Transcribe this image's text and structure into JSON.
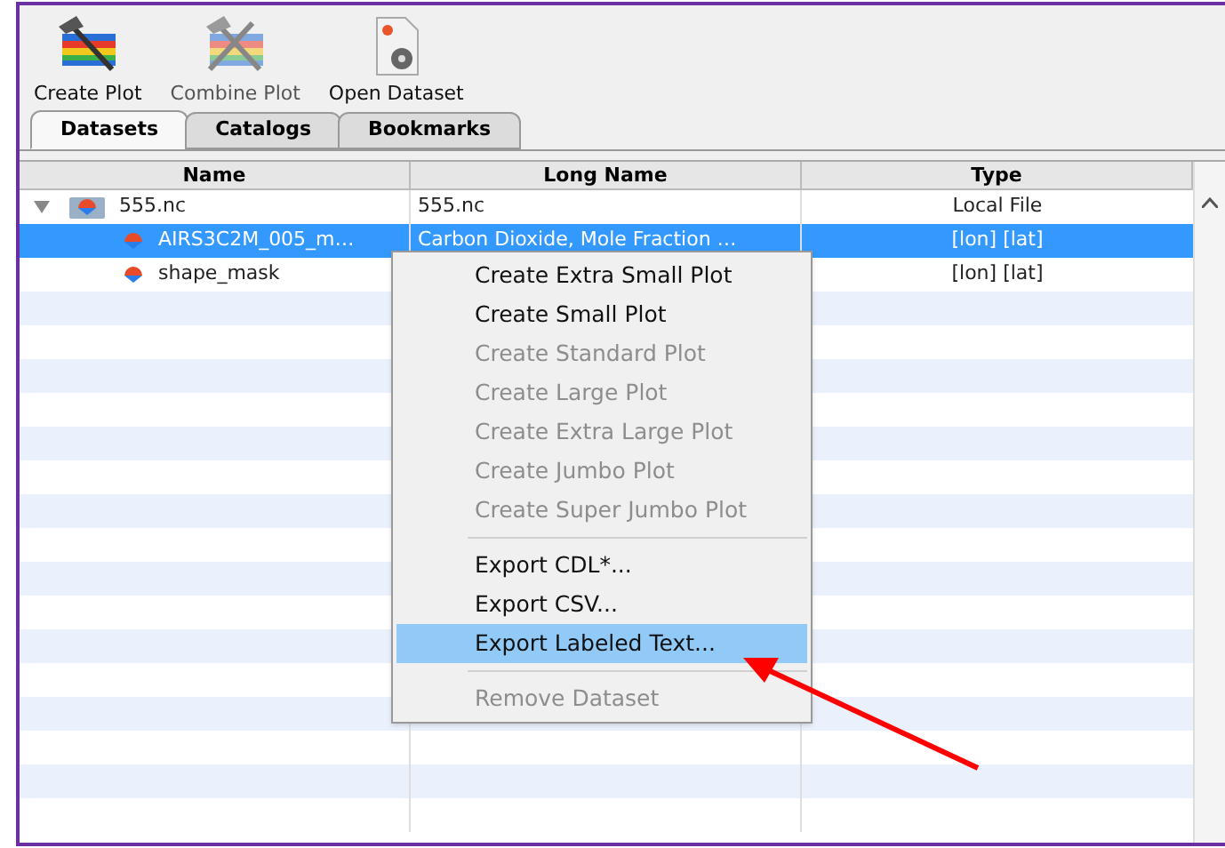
{
  "toolbar": [
    {
      "label": "Create Plot",
      "kind": "create",
      "disabled": false
    },
    {
      "label": "Combine Plot",
      "kind": "combine",
      "disabled": true
    },
    {
      "label": "Open Dataset",
      "kind": "open",
      "disabled": false
    }
  ],
  "tabs": [
    {
      "label": "Datasets",
      "selected": true
    },
    {
      "label": "Catalogs",
      "selected": false
    },
    {
      "label": "Bookmarks",
      "selected": false
    }
  ],
  "table": {
    "columns": [
      "Name",
      "Long Name",
      "Type"
    ],
    "rows": [
      {
        "name": "555.nc",
        "long_name": "555.nc",
        "type": "Local File",
        "kind": "file",
        "selected": false,
        "expanded": true,
        "children": [
          {
            "name": "AIRS3C2M_005_m…",
            "long_name": "Carbon Dioxide, Mole Fraction …",
            "type": "[lon] [lat]",
            "kind": "variable",
            "selected": true
          },
          {
            "name": "shape_mask",
            "type": "[lon] [lat]",
            "kind": "variable",
            "selected": false
          }
        ]
      }
    ]
  },
  "context_menu": [
    {
      "kind": "item",
      "label": "Create Extra Small Plot",
      "disabled": false,
      "selected": false
    },
    {
      "kind": "item",
      "label": "Create Small Plot",
      "disabled": false,
      "selected": false
    },
    {
      "kind": "item",
      "label": "Create Standard Plot",
      "disabled": true,
      "selected": false
    },
    {
      "kind": "item",
      "label": "Create Large Plot",
      "disabled": true,
      "selected": false
    },
    {
      "kind": "item",
      "label": "Create Extra Large Plot",
      "disabled": true,
      "selected": false
    },
    {
      "kind": "item",
      "label": "Create Jumbo Plot",
      "disabled": true,
      "selected": false
    },
    {
      "kind": "item",
      "label": "Create Super Jumbo Plot",
      "disabled": true,
      "selected": false
    },
    {
      "kind": "separator"
    },
    {
      "kind": "item",
      "label": "Export CDL*...",
      "disabled": false,
      "selected": false
    },
    {
      "kind": "item",
      "label": "Export CSV...",
      "disabled": false,
      "selected": false
    },
    {
      "kind": "item",
      "label": "Export Labeled Text...",
      "disabled": false,
      "selected": true
    },
    {
      "kind": "separator"
    },
    {
      "kind": "item",
      "label": "Remove Dataset",
      "disabled": true,
      "selected": false
    }
  ]
}
